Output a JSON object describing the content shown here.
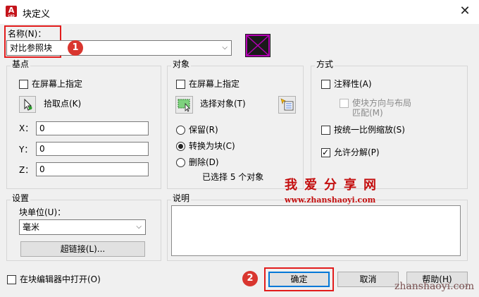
{
  "window": {
    "title": "块定义",
    "app_icon_letter": "A",
    "app_icon_sub": "CAD",
    "close_glyph": "✕"
  },
  "name": {
    "label": "名称(N)：",
    "value": "对比参照块",
    "annotation": "1"
  },
  "base_point": {
    "legend": "基点",
    "specify_on_screen": "在屏幕上指定",
    "pick_point": "拾取点(K)",
    "x_label": "X：",
    "x_value": "0",
    "y_label": "Y：",
    "y_value": "0",
    "z_label": "Z：",
    "z_value": "0"
  },
  "objects": {
    "legend": "对象",
    "specify_on_screen": "在屏幕上指定",
    "select_objects": "选择对象(T)",
    "retain": "保留(R)",
    "convert_to_block": "转换为块(C)",
    "delete": "删除(D)",
    "selected_count": "已选择 5 个对象",
    "selected_option": "convert_to_block"
  },
  "behavior": {
    "legend": "方式",
    "annotative": "注释性(A)",
    "annotative_checked": false,
    "match_orientation": "使块方向与布局",
    "match_orientation_2": "匹配(M)",
    "scale_uniformly": "按统一比例缩放(S)",
    "scale_uniformly_checked": false,
    "allow_exploding": "允许分解(P)",
    "allow_exploding_checked": true
  },
  "settings": {
    "legend": "设置",
    "block_unit_label": "块单位(U)：",
    "block_unit_value": "毫米",
    "hyperlink_button": "超链接(L)..."
  },
  "description": {
    "legend": "说明",
    "value": ""
  },
  "open_in_editor": {
    "label": "在块编辑器中打开(O)",
    "checked": false
  },
  "buttons": {
    "ok": "确定",
    "ok_annotation": "2",
    "cancel": "取消",
    "help": "帮助(H)"
  },
  "watermark": {
    "title": "我爱分享网",
    "url": "www.zhanshaoyi.com",
    "footer_url": "zhanshaoyi.com"
  },
  "colors": {
    "annotation_red": "#e21c1c",
    "preview_purple": "#b400b4"
  }
}
